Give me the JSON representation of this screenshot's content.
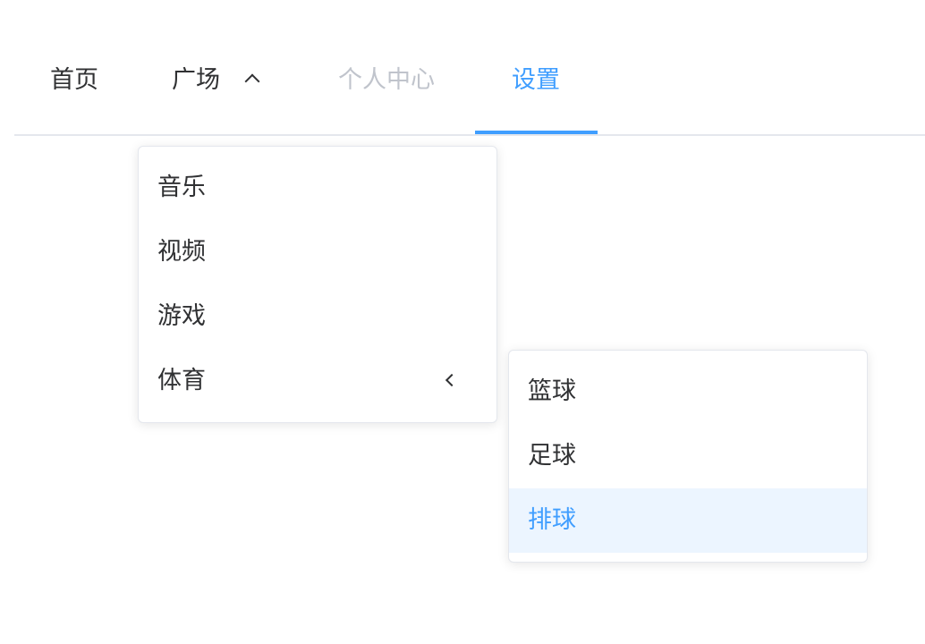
{
  "nav": {
    "items": [
      {
        "label": "首页"
      },
      {
        "label": "广场"
      },
      {
        "label": "个人中心"
      },
      {
        "label": "设置"
      }
    ],
    "active_index": 3,
    "disabled_index": 2,
    "colors": {
      "active": "#409eff",
      "disabled": "#c0c4cc",
      "text": "#303133"
    }
  },
  "plaza_menu": {
    "items": [
      {
        "label": "音乐"
      },
      {
        "label": "视频"
      },
      {
        "label": "游戏"
      },
      {
        "label": "体育",
        "has_submenu": true
      }
    ]
  },
  "sports_menu": {
    "items": [
      {
        "label": "篮球"
      },
      {
        "label": "足球"
      },
      {
        "label": "排球"
      }
    ],
    "active_index": 2,
    "active_bg": "#ecf5ff"
  },
  "icons": {
    "plaza_caret": "chevron-up-icon",
    "sports_arrow": "chevron-left-icon"
  }
}
